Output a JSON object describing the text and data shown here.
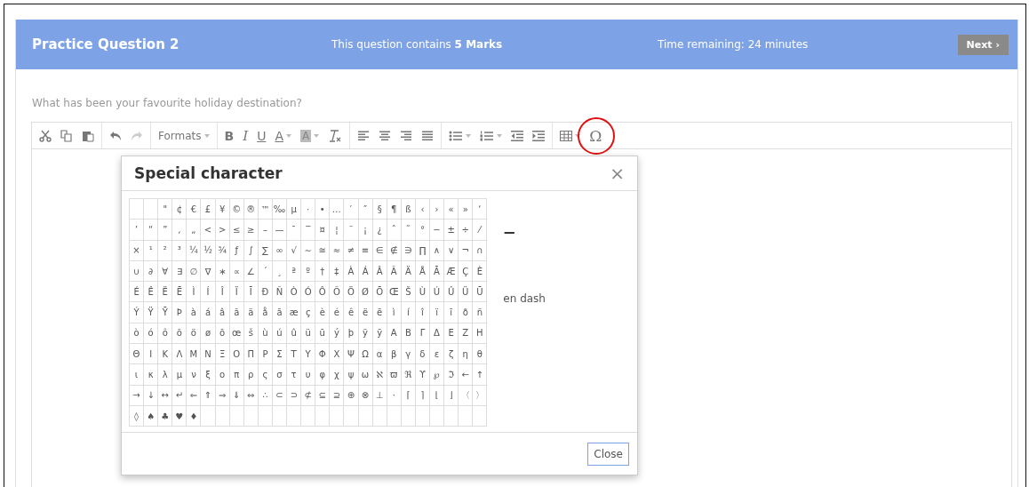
{
  "header": {
    "title": "Practice Question 2",
    "marks": "This question contains **5 Marks**",
    "time": "Time remaining: 24 minutes",
    "next": "Next ›"
  },
  "question": "What has been your favourite holiday destination?",
  "toolbar": [
    [
      {
        "kind": "cut",
        "disabled": false
      },
      {
        "kind": "copy",
        "disabled": false
      },
      {
        "kind": "paste",
        "disabled": false
      }
    ],
    [
      {
        "kind": "undo",
        "disabled": false
      },
      {
        "kind": "redo",
        "disabled": true
      }
    ],
    [
      {
        "kind": "menu",
        "label": "Formats",
        "caret": true,
        "disabled": false
      }
    ],
    [
      {
        "kind": "bold",
        "label": "B",
        "disabled": false
      },
      {
        "kind": "italic",
        "label": "I",
        "disabled": false
      },
      {
        "kind": "underline",
        "label": "U",
        "disabled": false
      },
      {
        "kind": "text-color",
        "label": "A",
        "caret": true,
        "disabled": false
      },
      {
        "kind": "highlight",
        "label": "A",
        "caret": true,
        "disabled": false
      },
      {
        "kind": "clear-format",
        "disabled": false
      }
    ],
    [
      {
        "kind": "align-left",
        "disabled": false
      },
      {
        "kind": "align-center",
        "disabled": false
      },
      {
        "kind": "align-right",
        "disabled": false
      },
      {
        "kind": "justify",
        "disabled": false
      }
    ],
    [
      {
        "kind": "bullet-list",
        "caret": true,
        "disabled": false
      },
      {
        "kind": "number-list",
        "caret": true,
        "disabled": false
      },
      {
        "kind": "outdent",
        "disabled": false
      },
      {
        "kind": "indent",
        "disabled": false
      }
    ],
    [
      {
        "kind": "table",
        "caret": true,
        "disabled": false
      },
      {
        "kind": "special-char",
        "label": "Ω",
        "disabled": false,
        "circled": true
      }
    ]
  ],
  "dialog": {
    "title": "Special character",
    "close": "×",
    "preview": "–",
    "preview_name": "en dash",
    "button": "Close",
    "rows": [
      [
        {
          "kind": "blank"
        },
        {
          "kind": "blank"
        },
        "\"",
        "¢",
        "€",
        "£",
        "¥",
        "©",
        "®",
        "™",
        "‰",
        "µ",
        "·",
        "•",
        "…",
        "′",
        "″",
        "§",
        "¶",
        "ß",
        "‹",
        "›",
        "«",
        "»",
        "‘"
      ],
      [
        "’",
        "“",
        "”",
        "‚",
        "„",
        "<",
        ">",
        "≤",
        "≥",
        "–",
        "—",
        "¯",
        "‾",
        "¤",
        "¦",
        "¨",
        "¡",
        "¿",
        "ˆ",
        "˜",
        "°",
        "−",
        "±",
        "÷",
        "⁄"
      ],
      [
        "×",
        "¹",
        "²",
        "³",
        "¼",
        "½",
        "¾",
        "ƒ",
        "∫",
        "∑",
        "∞",
        "√",
        "∼",
        "≅",
        "≈",
        "≠",
        "≡",
        "∈",
        "∉",
        "∋",
        "∏",
        "∧",
        "∨",
        "¬",
        "∩"
      ],
      [
        "∪",
        "∂",
        "∀",
        "∃",
        "∅",
        "∇",
        "∗",
        "∝",
        "∠",
        "´",
        "¸",
        "ª",
        "º",
        "†",
        "‡",
        "À",
        "Á",
        "Â",
        "Ã",
        "Ä",
        "Å",
        "Ā",
        "Æ",
        "Ç",
        "È"
      ],
      [
        "É",
        "Ê",
        "Ë",
        "Ē",
        "Ì",
        "Í",
        "Î",
        "Ï",
        "Ī",
        "Ð",
        "Ñ",
        "Ò",
        "Ó",
        "Ô",
        "Õ",
        "Ö",
        "Ø",
        "Ō",
        "Œ",
        "Š",
        "Ù",
        "Ú",
        "Û",
        "Ü",
        "Ū"
      ],
      [
        "Ý",
        "Ÿ",
        "Ȳ",
        "Þ",
        "à",
        "á",
        "â",
        "ã",
        "ä",
        "å",
        "ā",
        "æ",
        "ç",
        "è",
        "é",
        "ê",
        "ë",
        "ē",
        "ì",
        "í",
        "î",
        "ï",
        "ī",
        "ð",
        "ñ"
      ],
      [
        "ò",
        "ó",
        "ô",
        "õ",
        "ö",
        "ø",
        "ō",
        "œ",
        "š",
        "ù",
        "ú",
        "û",
        "ü",
        "ū",
        "ý",
        "þ",
        "ÿ",
        "ȳ",
        "Α",
        "Β",
        "Γ",
        "Δ",
        "Ε",
        "Ζ",
        "Η"
      ],
      [
        "Θ",
        "Ι",
        "Κ",
        "Λ",
        "Μ",
        "Ν",
        "Ξ",
        "Ο",
        "Π",
        "Ρ",
        "Σ",
        "Τ",
        "Υ",
        "Φ",
        "Χ",
        "Ψ",
        "Ω",
        "α",
        "β",
        "γ",
        "δ",
        "ε",
        "ζ",
        "η",
        "θ"
      ],
      [
        "ι",
        "κ",
        "λ",
        "μ",
        "ν",
        "ξ",
        "ο",
        "π",
        "ρ",
        "ς",
        "σ",
        "τ",
        "υ",
        "φ",
        "χ",
        "ψ",
        "ω",
        "ℵ",
        "ϖ",
        "ℜ",
        "ϒ",
        "℘",
        "ℑ",
        "←",
        "↑"
      ],
      [
        "→",
        "↓",
        "↔",
        "↵",
        "⇐",
        "⇑",
        "⇒",
        "⇓",
        "⇔",
        "∴",
        "⊂",
        "⊃",
        "⊄",
        "⊆",
        "⊇",
        "⊕",
        "⊗",
        "⊥",
        "⋅",
        "⌈",
        "⌉",
        "⌊",
        "⌋",
        "〈",
        "〉"
      ],
      [
        "◊",
        "♠",
        "♣",
        "♥",
        "♦"
      ]
    ]
  }
}
